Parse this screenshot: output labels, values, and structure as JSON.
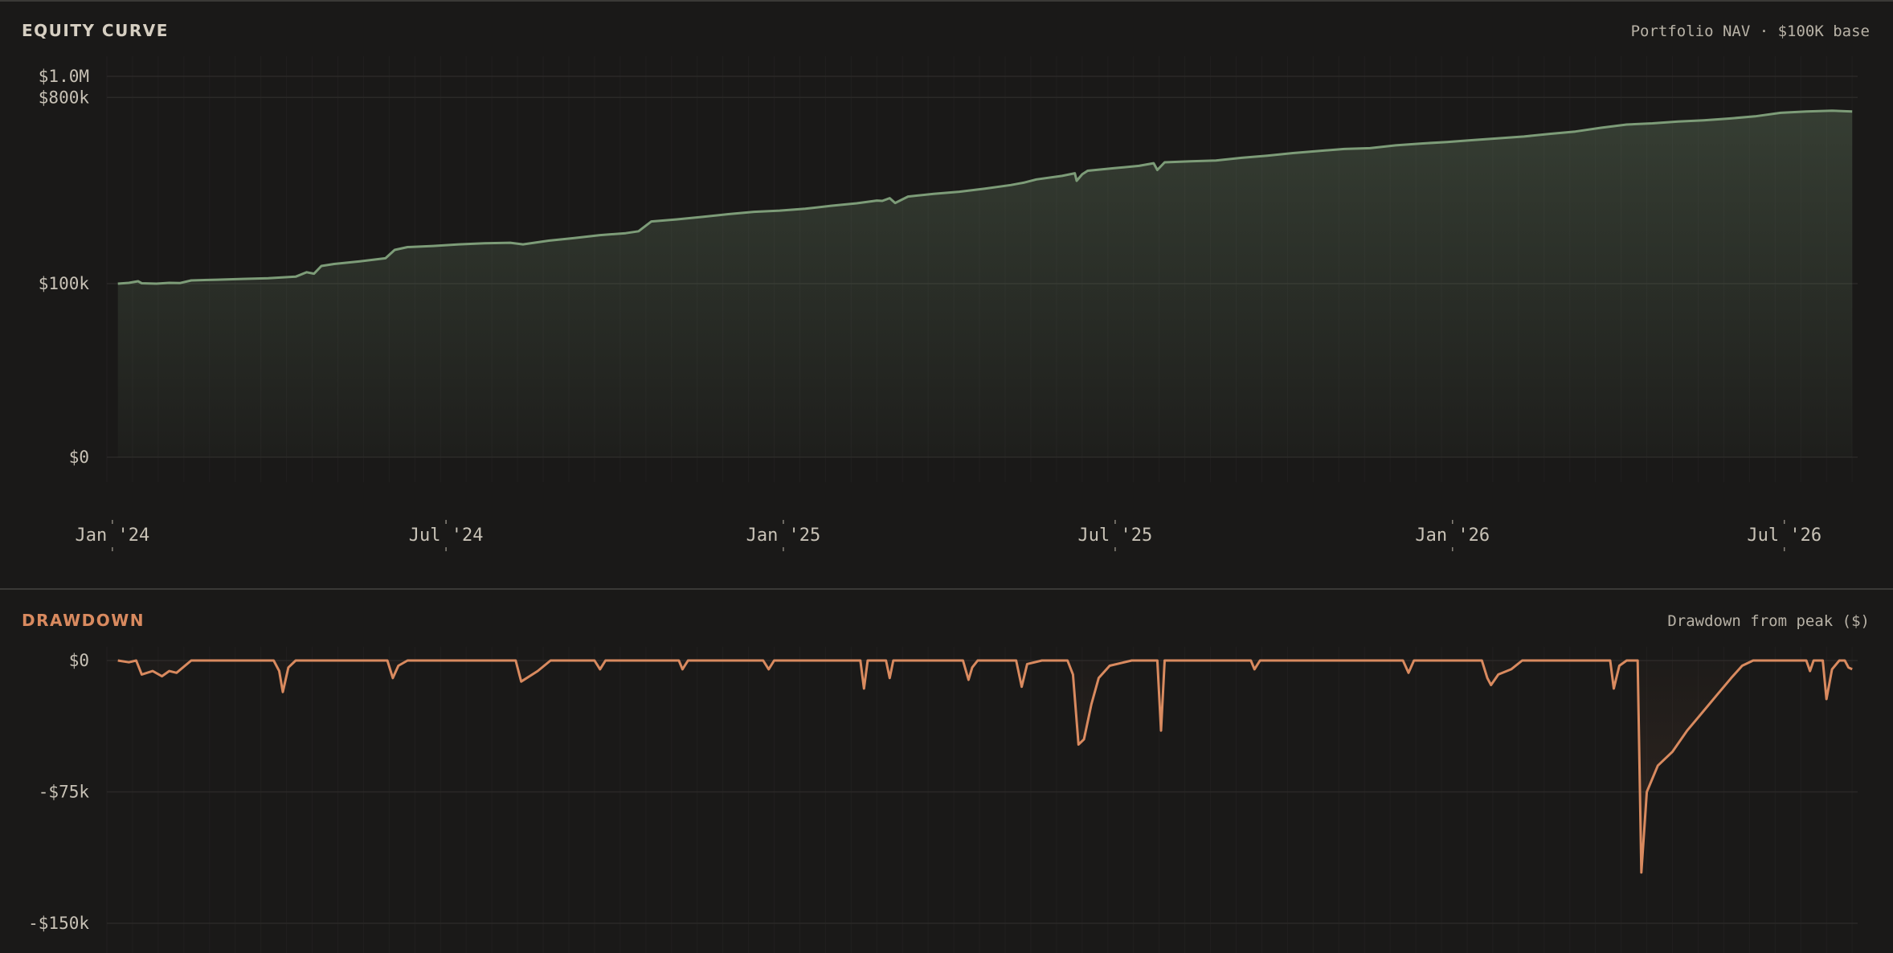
{
  "equity_panel": {
    "title": "EQUITY CURVE",
    "subtitle": "Portfolio NAV · $100K base",
    "title_color": "#d6cfc2"
  },
  "drawdown_panel": {
    "title": "DRAWDOWN",
    "subtitle": "Drawdown from peak ($)",
    "title_color": "#d98a5f"
  },
  "colors": {
    "background": "#1a1918",
    "grid": "#2a2927",
    "divider": "#3a3936",
    "text": "#c8c2b6",
    "equity_line": "#7d9c78",
    "drawdown_line": "#d98a5f"
  },
  "chart_data": [
    {
      "type": "area",
      "title": "EQUITY CURVE",
      "subtitle": "Portfolio NAV · $100K base",
      "x_type": "date",
      "xlim": [
        "2023-12-29",
        "2026-08-10"
      ],
      "y_scale": "log1p",
      "ylim": [
        0,
        1000000
      ],
      "y_ticks": [
        {
          "value": 0,
          "label": "$0"
        },
        {
          "value": 100000,
          "label": "$100k"
        },
        {
          "value": 800000,
          "label": "$800k"
        },
        {
          "value": 1000000,
          "label": "$1.0M"
        }
      ],
      "x_ticks": [
        {
          "value": "2024-01-01",
          "label": "Jan '24"
        },
        {
          "value": "2024-07-01",
          "label": "Jul '24"
        },
        {
          "value": "2025-01-01",
          "label": "Jan '25"
        },
        {
          "value": "2025-07-01",
          "label": "Jul '25"
        },
        {
          "value": "2026-01-01",
          "label": "Jan '26"
        },
        {
          "value": "2026-07-01",
          "label": "Jul '26"
        }
      ],
      "grid": true,
      "series": [
        {
          "points": [
            [
              "2024-01-04",
              100000
            ],
            [
              "2024-01-10",
              101000
            ],
            [
              "2024-01-15",
              103000
            ],
            [
              "2024-01-17",
              100500
            ],
            [
              "2024-01-25",
              100000
            ],
            [
              "2024-02-01",
              101000
            ],
            [
              "2024-02-07",
              100800
            ],
            [
              "2024-02-13",
              104000
            ],
            [
              "2024-02-27",
              105000
            ],
            [
              "2024-03-12",
              106000
            ],
            [
              "2024-03-26",
              107000
            ],
            [
              "2024-04-10",
              109000
            ],
            [
              "2024-04-16",
              115000
            ],
            [
              "2024-04-20",
              113000
            ],
            [
              "2024-04-24",
              124000
            ],
            [
              "2024-05-01",
              127000
            ],
            [
              "2024-05-15",
              131000
            ],
            [
              "2024-05-29",
              136000
            ],
            [
              "2024-06-03",
              150000
            ],
            [
              "2024-06-10",
              155000
            ],
            [
              "2024-06-24",
              157000
            ],
            [
              "2024-07-08",
              160000
            ],
            [
              "2024-07-22",
              162000
            ],
            [
              "2024-08-05",
              163000
            ],
            [
              "2024-08-12",
              160000
            ],
            [
              "2024-08-26",
              167000
            ],
            [
              "2024-09-09",
              172000
            ],
            [
              "2024-09-23",
              178000
            ],
            [
              "2024-10-07",
              182000
            ],
            [
              "2024-10-14",
              186000
            ],
            [
              "2024-10-21",
              208000
            ],
            [
              "2024-11-04",
              213000
            ],
            [
              "2024-11-18",
              219000
            ],
            [
              "2024-12-02",
              226000
            ],
            [
              "2024-12-16",
              232000
            ],
            [
              "2024-12-30",
              235000
            ],
            [
              "2025-01-13",
              240000
            ],
            [
              "2025-01-27",
              248000
            ],
            [
              "2025-02-10",
              255000
            ],
            [
              "2025-02-21",
              263000
            ],
            [
              "2025-02-24",
              262000
            ],
            [
              "2025-02-28",
              270000
            ],
            [
              "2025-03-03",
              256000
            ],
            [
              "2025-03-10",
              275000
            ],
            [
              "2025-03-24",
              283000
            ],
            [
              "2025-04-07",
              290000
            ],
            [
              "2025-04-21",
              300000
            ],
            [
              "2025-05-05",
              312000
            ],
            [
              "2025-05-12",
              320000
            ],
            [
              "2025-05-19",
              332000
            ],
            [
              "2025-06-02",
              345000
            ],
            [
              "2025-06-09",
              355000
            ],
            [
              "2025-06-10",
              327000
            ],
            [
              "2025-06-13",
              351000
            ],
            [
              "2025-06-16",
              365000
            ],
            [
              "2025-06-30",
              375000
            ],
            [
              "2025-07-14",
              385000
            ],
            [
              "2025-07-22",
              396000
            ],
            [
              "2025-07-24",
              368000
            ],
            [
              "2025-07-28",
              400000
            ],
            [
              "2025-08-11",
              404000
            ],
            [
              "2025-08-25",
              408000
            ],
            [
              "2025-09-08",
              420000
            ],
            [
              "2025-09-22",
              430000
            ],
            [
              "2025-10-06",
              442000
            ],
            [
              "2025-10-20",
              452000
            ],
            [
              "2025-11-03",
              462000
            ],
            [
              "2025-11-17",
              466000
            ],
            [
              "2025-12-01",
              480000
            ],
            [
              "2025-12-15",
              490000
            ],
            [
              "2025-12-29",
              498000
            ],
            [
              "2026-01-12",
              508000
            ],
            [
              "2026-01-26",
              518000
            ],
            [
              "2026-02-09",
              528000
            ],
            [
              "2026-02-23",
              543000
            ],
            [
              "2026-03-09",
              557000
            ],
            [
              "2026-03-23",
              580000
            ],
            [
              "2026-04-06",
              600000
            ],
            [
              "2026-04-20",
              608000
            ],
            [
              "2026-05-04",
              620000
            ],
            [
              "2026-05-18",
              628000
            ],
            [
              "2026-06-01",
              640000
            ],
            [
              "2026-06-15",
              655000
            ],
            [
              "2026-06-29",
              680000
            ],
            [
              "2026-07-13",
              690000
            ],
            [
              "2026-07-27",
              695000
            ],
            [
              "2026-08-07",
              690000
            ]
          ]
        }
      ]
    },
    {
      "type": "line",
      "title": "DRAWDOWN",
      "subtitle": "Drawdown from peak ($)",
      "x_type": "date",
      "xlim": [
        "2023-12-29",
        "2026-08-10"
      ],
      "ylim": [
        -150000,
        0
      ],
      "y_ticks": [
        {
          "value": 0,
          "label": "$0"
        },
        {
          "value": -75000,
          "label": "-$75k"
        },
        {
          "value": -150000,
          "label": "-$150k"
        }
      ],
      "grid": true,
      "series": [
        {
          "points": [
            [
              "2024-01-04",
              0
            ],
            [
              "2024-01-10",
              -1000
            ],
            [
              "2024-01-14",
              0
            ],
            [
              "2024-01-17",
              -8000
            ],
            [
              "2024-01-23",
              -6000
            ],
            [
              "2024-01-28",
              -9000
            ],
            [
              "2024-02-01",
              -6000
            ],
            [
              "2024-02-05",
              -7000
            ],
            [
              "2024-02-13",
              0
            ],
            [
              "2024-03-29",
              0
            ],
            [
              "2024-04-01",
              -6000
            ],
            [
              "2024-04-03",
              -18000
            ],
            [
              "2024-04-06",
              -4000
            ],
            [
              "2024-04-10",
              0
            ],
            [
              "2024-05-30",
              0
            ],
            [
              "2024-06-02",
              -10000
            ],
            [
              "2024-06-05",
              -3000
            ],
            [
              "2024-06-10",
              0
            ],
            [
              "2024-08-08",
              0
            ],
            [
              "2024-08-11",
              -12000
            ],
            [
              "2024-08-20",
              -6000
            ],
            [
              "2024-08-27",
              0
            ],
            [
              "2024-09-20",
              0
            ],
            [
              "2024-09-23",
              -5000
            ],
            [
              "2024-09-26",
              0
            ],
            [
              "2024-11-05",
              0
            ],
            [
              "2024-11-07",
              -5000
            ],
            [
              "2024-11-10",
              0
            ],
            [
              "2024-12-21",
              0
            ],
            [
              "2024-12-24",
              -5000
            ],
            [
              "2024-12-27",
              0
            ],
            [
              "2025-02-12",
              0
            ],
            [
              "2025-02-14",
              -16000
            ],
            [
              "2025-02-16",
              0
            ],
            [
              "2025-02-26",
              0
            ],
            [
              "2025-02-28",
              -10000
            ],
            [
              "2025-03-02",
              0
            ],
            [
              "2025-04-09",
              0
            ],
            [
              "2025-04-12",
              -11000
            ],
            [
              "2025-04-14",
              -4000
            ],
            [
              "2025-04-17",
              0
            ],
            [
              "2025-05-08",
              0
            ],
            [
              "2025-05-11",
              -15000
            ],
            [
              "2025-05-14",
              -2000
            ],
            [
              "2025-05-22",
              0
            ],
            [
              "2025-06-05",
              0
            ],
            [
              "2025-06-08",
              -8000
            ],
            [
              "2025-06-11",
              -48000
            ],
            [
              "2025-06-14",
              -45000
            ],
            [
              "2025-06-18",
              -25000
            ],
            [
              "2025-06-22",
              -10000
            ],
            [
              "2025-06-28",
              -3000
            ],
            [
              "2025-07-10",
              0
            ],
            [
              "2025-07-24",
              0
            ],
            [
              "2025-07-26",
              -40000
            ],
            [
              "2025-07-28",
              0
            ],
            [
              "2025-09-13",
              0
            ],
            [
              "2025-09-15",
              -5000
            ],
            [
              "2025-09-18",
              0
            ],
            [
              "2025-12-05",
              0
            ],
            [
              "2025-12-08",
              -7000
            ],
            [
              "2025-12-11",
              0
            ],
            [
              "2026-01-17",
              0
            ],
            [
              "2026-01-20",
              -10000
            ],
            [
              "2026-01-22",
              -14000
            ],
            [
              "2026-01-26",
              -8000
            ],
            [
              "2026-02-02",
              -5000
            ],
            [
              "2026-02-08",
              0
            ],
            [
              "2026-03-28",
              0
            ],
            [
              "2026-03-30",
              -16000
            ],
            [
              "2026-04-02",
              -3000
            ],
            [
              "2026-04-06",
              0
            ],
            [
              "2026-04-12",
              0
            ],
            [
              "2026-04-14",
              -121000
            ],
            [
              "2026-04-17",
              -75000
            ],
            [
              "2026-04-23",
              -60000
            ],
            [
              "2026-05-01",
              -52000
            ],
            [
              "2026-05-09",
              -40000
            ],
            [
              "2026-05-17",
              -30000
            ],
            [
              "2026-05-25",
              -20000
            ],
            [
              "2026-06-02",
              -10000
            ],
            [
              "2026-06-08",
              -3000
            ],
            [
              "2026-06-14",
              0
            ],
            [
              "2026-07-13",
              0
            ],
            [
              "2026-07-15",
              -6000
            ],
            [
              "2026-07-17",
              0
            ],
            [
              "2026-07-22",
              0
            ],
            [
              "2026-07-24",
              -22000
            ],
            [
              "2026-07-27",
              -5000
            ],
            [
              "2026-07-31",
              0
            ],
            [
              "2026-08-03",
              0
            ],
            [
              "2026-08-05",
              -4000
            ],
            [
              "2026-08-07",
              -5000
            ]
          ]
        }
      ]
    }
  ]
}
